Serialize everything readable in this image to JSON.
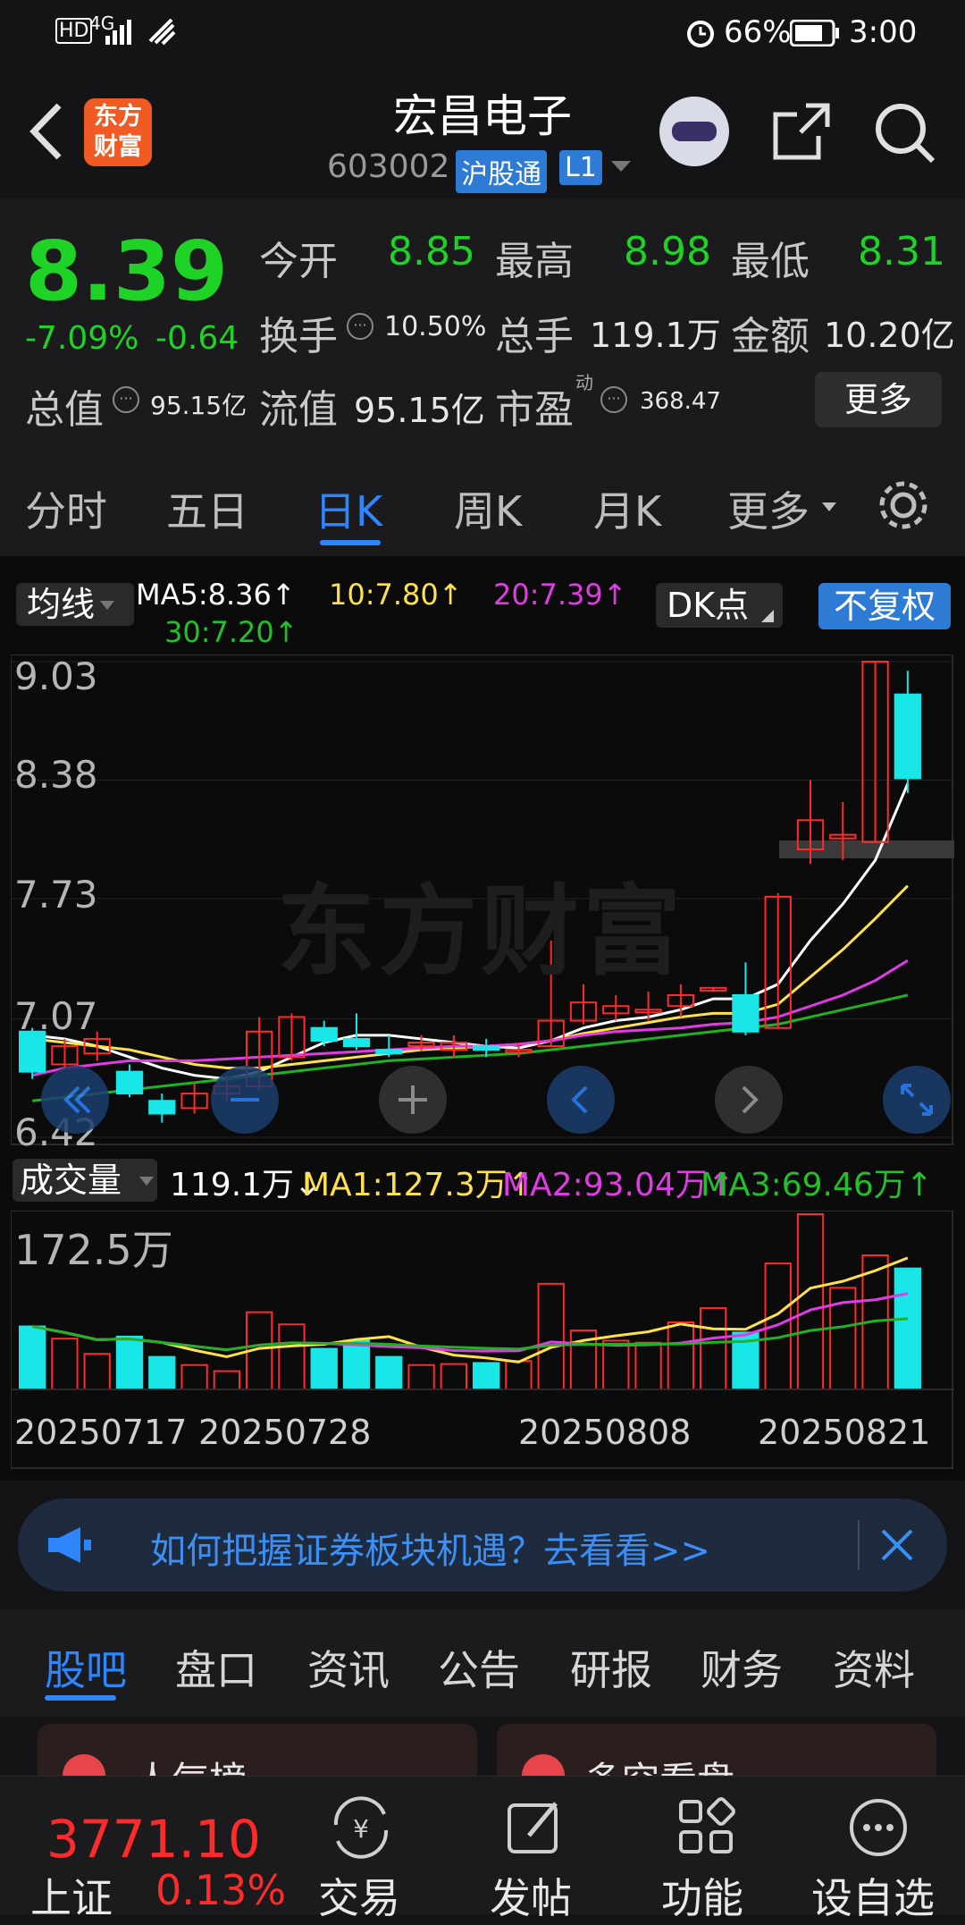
{
  "status": {
    "signal": "4G",
    "battery": "66%",
    "time": "3:00"
  },
  "header": {
    "logo_text": "东方财富",
    "stock_name": "宏昌电子",
    "code": "603002",
    "badge": "沪股通",
    "level": "L1"
  },
  "quote": {
    "price": "8.39",
    "change_pct": "-7.09%",
    "change": "-0.64",
    "fields": [
      {
        "label": "今开",
        "value": "8.85"
      },
      {
        "label": "最高",
        "value": "8.98"
      },
      {
        "label": "最低",
        "value": "8.31"
      },
      {
        "label": "换手",
        "value": "10.50%"
      },
      {
        "label": "总手",
        "value": "119.1万"
      },
      {
        "label": "金额",
        "value": "10.20亿"
      },
      {
        "label": "总值",
        "value": "95.15亿"
      },
      {
        "label": "流值",
        "value": "95.15亿"
      },
      {
        "label": "市盈",
        "value": "368.47"
      }
    ],
    "pe_sup": "动",
    "more": "更多"
  },
  "ktabs": [
    "分时",
    "五日",
    "日K",
    "周K",
    "月K",
    "更多"
  ],
  "ma": {
    "selector": "均线",
    "ma5": "MA5:8.36↑",
    "ma10": "10:7.80↑",
    "ma20": "20:7.39↑",
    "ma30": "30:7.20↑",
    "dk": "DK点",
    "adjust": "不复权"
  },
  "chart_data": {
    "type": "candlestick",
    "yticks": [
      "9.03",
      "8.38",
      "7.73",
      "7.07",
      "6.42"
    ],
    "ylim": [
      6.42,
      9.03
    ],
    "candles": [
      [
        7.0,
        6.78,
        7.02,
        6.74
      ],
      [
        6.82,
        6.92,
        6.96,
        6.8
      ],
      [
        6.88,
        6.96,
        7.0,
        6.84
      ],
      [
        6.78,
        6.66,
        6.82,
        6.64
      ],
      [
        6.62,
        6.55,
        6.66,
        6.5
      ],
      [
        6.58,
        6.66,
        6.72,
        6.55
      ],
      [
        6.66,
        6.7,
        6.76,
        6.62
      ],
      [
        6.7,
        7.0,
        7.08,
        6.68
      ],
      [
        6.86,
        7.08,
        7.1,
        6.84
      ],
      [
        7.02,
        6.95,
        7.06,
        6.92
      ],
      [
        6.96,
        6.92,
        7.1,
        6.9
      ],
      [
        6.9,
        6.88,
        6.98,
        6.86
      ],
      [
        6.92,
        6.94,
        6.98,
        6.89
      ],
      [
        6.9,
        6.94,
        6.98,
        6.86
      ],
      [
        6.92,
        6.9,
        6.96,
        6.86
      ],
      [
        6.9,
        6.9,
        6.94,
        6.86
      ],
      [
        6.92,
        7.06,
        7.5,
        6.92
      ],
      [
        7.06,
        7.16,
        7.26,
        7.04
      ],
      [
        7.1,
        7.14,
        7.2,
        7.06
      ],
      [
        7.12,
        7.12,
        7.22,
        7.06
      ],
      [
        7.14,
        7.2,
        7.26,
        7.08
      ],
      [
        7.24,
        7.24,
        7.24,
        7.22
      ],
      [
        7.2,
        7.0,
        7.38,
        6.98
      ],
      [
        7.02,
        7.74,
        7.76,
        7.02
      ],
      [
        8.0,
        8.16,
        8.38,
        7.92
      ],
      [
        8.06,
        8.08,
        8.26,
        7.94
      ],
      [
        8.04,
        9.03,
        9.03,
        8.04
      ],
      [
        8.85,
        8.39,
        8.98,
        8.31
      ]
    ],
    "ma_lines": {
      "white": [
        6.98,
        6.96,
        6.92,
        6.86,
        6.8,
        6.76,
        6.74,
        6.78,
        6.86,
        6.94,
        6.98,
        6.98,
        6.96,
        6.94,
        6.92,
        6.91,
        6.95,
        7.02,
        7.06,
        7.08,
        7.12,
        7.18,
        7.18,
        7.26,
        7.5,
        7.7,
        7.94,
        8.36
      ],
      "yellow": [
        6.96,
        6.94,
        6.92,
        6.9,
        6.86,
        6.82,
        6.8,
        6.8,
        6.82,
        6.84,
        6.86,
        6.88,
        6.9,
        6.91,
        6.92,
        6.93,
        6.95,
        6.99,
        7.02,
        7.05,
        7.08,
        7.1,
        7.1,
        7.15,
        7.3,
        7.45,
        7.62,
        7.8
      ],
      "magenta": [
        6.76,
        6.8,
        6.82,
        6.84,
        6.84,
        6.84,
        6.85,
        6.86,
        6.87,
        6.88,
        6.89,
        6.9,
        6.91,
        6.92,
        6.92,
        6.93,
        6.95,
        6.98,
        7.0,
        7.01,
        7.02,
        7.04,
        7.05,
        7.08,
        7.14,
        7.2,
        7.28,
        7.39
      ],
      "green": [
        6.62,
        6.64,
        6.66,
        6.68,
        6.7,
        6.72,
        6.74,
        6.76,
        6.78,
        6.8,
        6.82,
        6.84,
        6.85,
        6.86,
        6.87,
        6.88,
        6.9,
        6.92,
        6.94,
        6.96,
        6.98,
        7.0,
        7.02,
        7.04,
        7.08,
        7.12,
        7.16,
        7.2
      ]
    }
  },
  "volume": {
    "selector": "成交量",
    "current": "119.1万↓",
    "ma1": "MA1:127.3万↑",
    "ma2": "MA2:93.04万↑",
    "ma3": "MA3:69.46万↑",
    "max_label": "172.5万",
    "values": [
      62,
      50,
      35,
      52,
      32,
      24,
      18,
      76,
      64,
      40,
      48,
      32,
      24,
      25,
      26,
      28,
      104,
      58,
      48,
      46,
      66,
      80,
      56,
      124,
      172.5,
      100,
      132,
      119.1
    ],
    "dates": [
      "20250717",
      "20250728",
      "20250808",
      "20250821"
    ]
  },
  "banner": {
    "text": "如何把握证券板块机遇？去看看>>"
  },
  "subtabs": [
    "股吧",
    "盘口",
    "资讯",
    "公告",
    "研报",
    "财务",
    "资料"
  ],
  "peek": [
    "人气榜",
    "多空看盘"
  ],
  "index": {
    "value": "3771.10",
    "name": "上证",
    "pct": "0.13%"
  },
  "nav": [
    "交易",
    "发帖",
    "功能",
    "设自选"
  ]
}
